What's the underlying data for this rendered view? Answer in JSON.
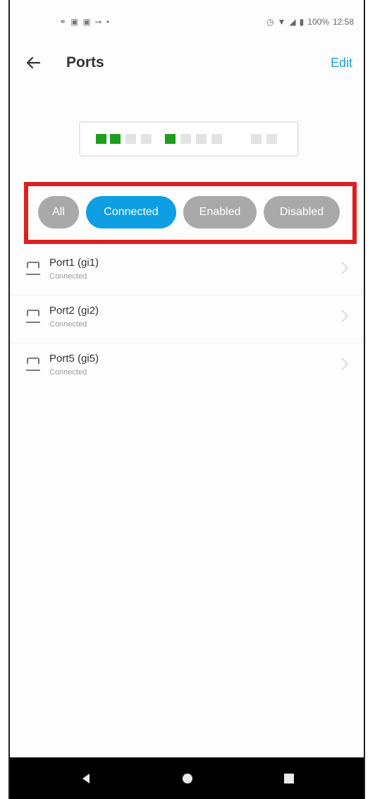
{
  "status_bar": {
    "left_icons": [
      "notification-icon",
      "gallery-icon",
      "gallery-icon",
      "arrow-icon",
      "dot-icon"
    ],
    "battery": "100%",
    "time": "12:58"
  },
  "header": {
    "title": "Ports",
    "edit_label": "Edit"
  },
  "port_panel": {
    "leds": [
      {
        "state": "connected"
      },
      {
        "state": "connected"
      },
      {
        "state": "idle"
      },
      {
        "state": "idle"
      },
      {
        "state": "connected"
      },
      {
        "state": "idle"
      },
      {
        "state": "idle"
      },
      {
        "state": "idle"
      },
      {
        "state": "idle"
      },
      {
        "state": "idle"
      }
    ],
    "colors": {
      "connected": "#1e9e1e",
      "idle": "#e3e3e3"
    }
  },
  "filters": {
    "items": [
      {
        "label": "All",
        "active": false
      },
      {
        "label": "Connected",
        "active": true
      },
      {
        "label": "Enabled",
        "active": false
      },
      {
        "label": "Disabled",
        "active": false
      }
    ],
    "highlight_color": "#dd1f1f",
    "active_color": "#0d9fe2"
  },
  "ports": [
    {
      "name": "Port1 (gi1)",
      "status": "Connected"
    },
    {
      "name": "Port2 (gi2)",
      "status": "Connected"
    },
    {
      "name": "Port5 (gi5)",
      "status": "Connected"
    }
  ]
}
